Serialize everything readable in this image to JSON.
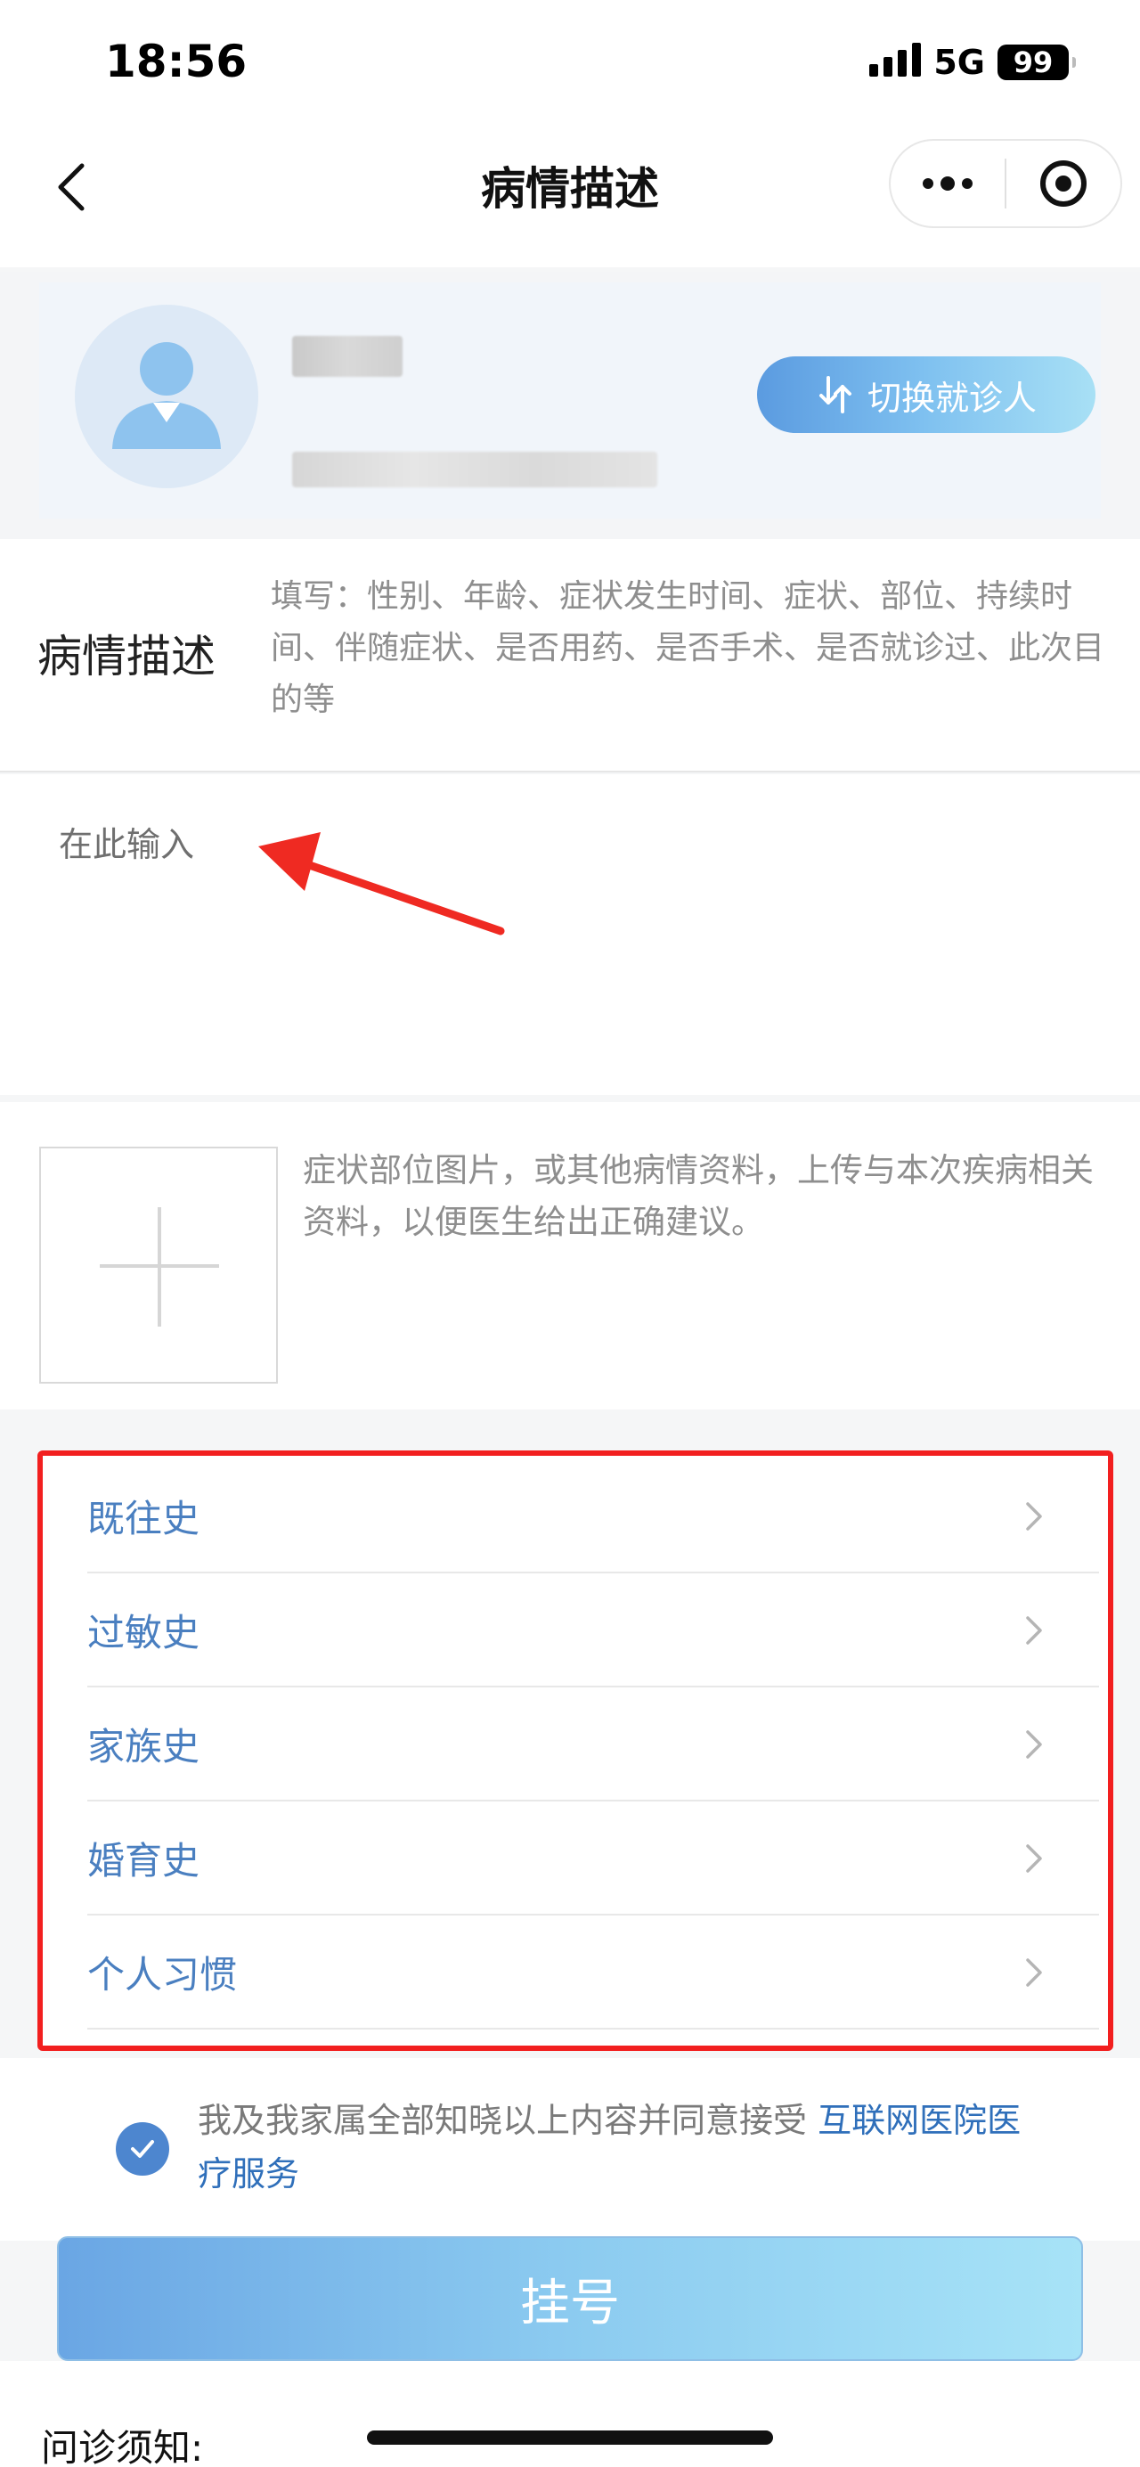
{
  "status_bar": {
    "time": "18:56",
    "network": "5G",
    "battery": "99"
  },
  "nav": {
    "title": "病情描述",
    "back_icon": "chevron-left-icon",
    "more_icon": "more-dots-icon",
    "close_icon": "target-icon"
  },
  "patient": {
    "switch_label": "切换就诊人",
    "switch_icon": "swap-arrows-icon",
    "accent": "#5b9be0"
  },
  "description": {
    "title": "病情描述",
    "hint": "填写：性别、年龄、症状发生时间、症状、部位、持续时间、伴随症状、是否用药、是否手术、是否就诊过、此次目的等",
    "placeholder": "在此输入"
  },
  "upload": {
    "hint": "症状部位图片，或其他病情资料，上传与本次疾病相关资料，以便医生给出正确建议。"
  },
  "history": {
    "items": [
      {
        "label": "既往史"
      },
      {
        "label": "过敏史"
      },
      {
        "label": "家族史"
      },
      {
        "label": "婚育史"
      },
      {
        "label": "个人习惯"
      }
    ],
    "highlight_color": "#f21f1f"
  },
  "agreement": {
    "text": "我及我家属全部知晓以上内容并同意接受 ",
    "link": "互联网医院医疗服务",
    "checked": true
  },
  "submit": {
    "label": "挂号"
  },
  "notice": {
    "label": "问诊须知:"
  }
}
